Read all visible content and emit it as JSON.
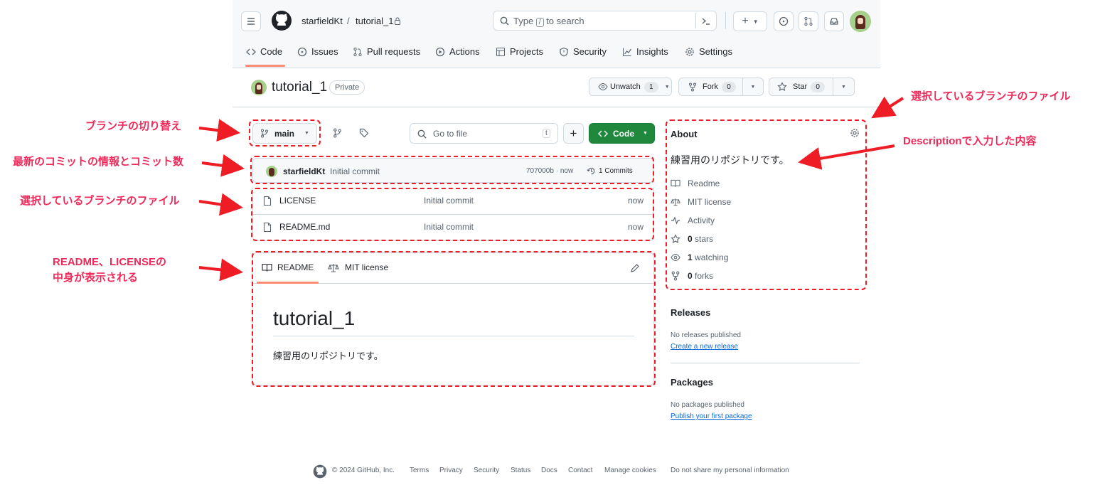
{
  "header": {
    "owner": "starfieldKt",
    "separator": "/",
    "repo": "tutorial_1",
    "search_placeholder": "Type / to search",
    "slash_key": "/"
  },
  "nav_tabs": [
    "Code",
    "Issues",
    "Pull requests",
    "Actions",
    "Projects",
    "Security",
    "Insights",
    "Settings"
  ],
  "repo": {
    "name": "tutorial_1",
    "visibility": "Private",
    "unwatch_label": "Unwatch",
    "unwatch_count": "1",
    "fork_label": "Fork",
    "fork_count": "0",
    "star_label": "Star",
    "star_count": "0"
  },
  "toolbar": {
    "branch": "main",
    "goto_placeholder": "Go to file",
    "goto_key": "t",
    "plus": "+",
    "code_label": "Code"
  },
  "commit": {
    "author": "starfieldKt",
    "message": "Initial commit",
    "hash_time": "707000b · now",
    "commits": "1 Commits"
  },
  "files": [
    {
      "name": "LICENSE",
      "message": "Initial commit",
      "time": "now"
    },
    {
      "name": "README.md",
      "message": "Initial commit",
      "time": "now"
    }
  ],
  "readme": {
    "tab_readme": "README",
    "tab_license": "MIT license",
    "heading": "tutorial_1",
    "body": "練習用のリポジトリです。"
  },
  "about": {
    "title": "About",
    "description": "練習用のリポジトリです。",
    "items": {
      "readme": "Readme",
      "license": "MIT license",
      "activity": "Activity",
      "stars_n": "0",
      "stars": "stars",
      "watching_n": "1",
      "watching": "watching",
      "forks_n": "0",
      "forks": "forks"
    }
  },
  "releases": {
    "title": "Releases",
    "empty": "No releases published",
    "link": "Create a new release"
  },
  "packages": {
    "title": "Packages",
    "empty": "No packages published",
    "link": "Publish your first package"
  },
  "footer": [
    "© 2024 GitHub, Inc.",
    "Terms",
    "Privacy",
    "Security",
    "Status",
    "Docs",
    "Contact",
    "Manage cookies",
    "Do not share my personal information"
  ],
  "annotations": {
    "branch_switch": "ブランチの切り替え",
    "latest_commit": "最新のコミットの情報とコミット数",
    "branch_files": "選択しているブランチのファイル",
    "readme_license_1": "README、LICENSEの",
    "readme_license_2": "中身が表示される",
    "branch_files_top": "選択しているブランチのファイル",
    "description": "Descriptionで入力した内容"
  },
  "colors": {
    "annotation": "#ee2a5a",
    "dashed_box": "#ee1c25",
    "code_button": "#1f883d",
    "link": "#0969da"
  }
}
